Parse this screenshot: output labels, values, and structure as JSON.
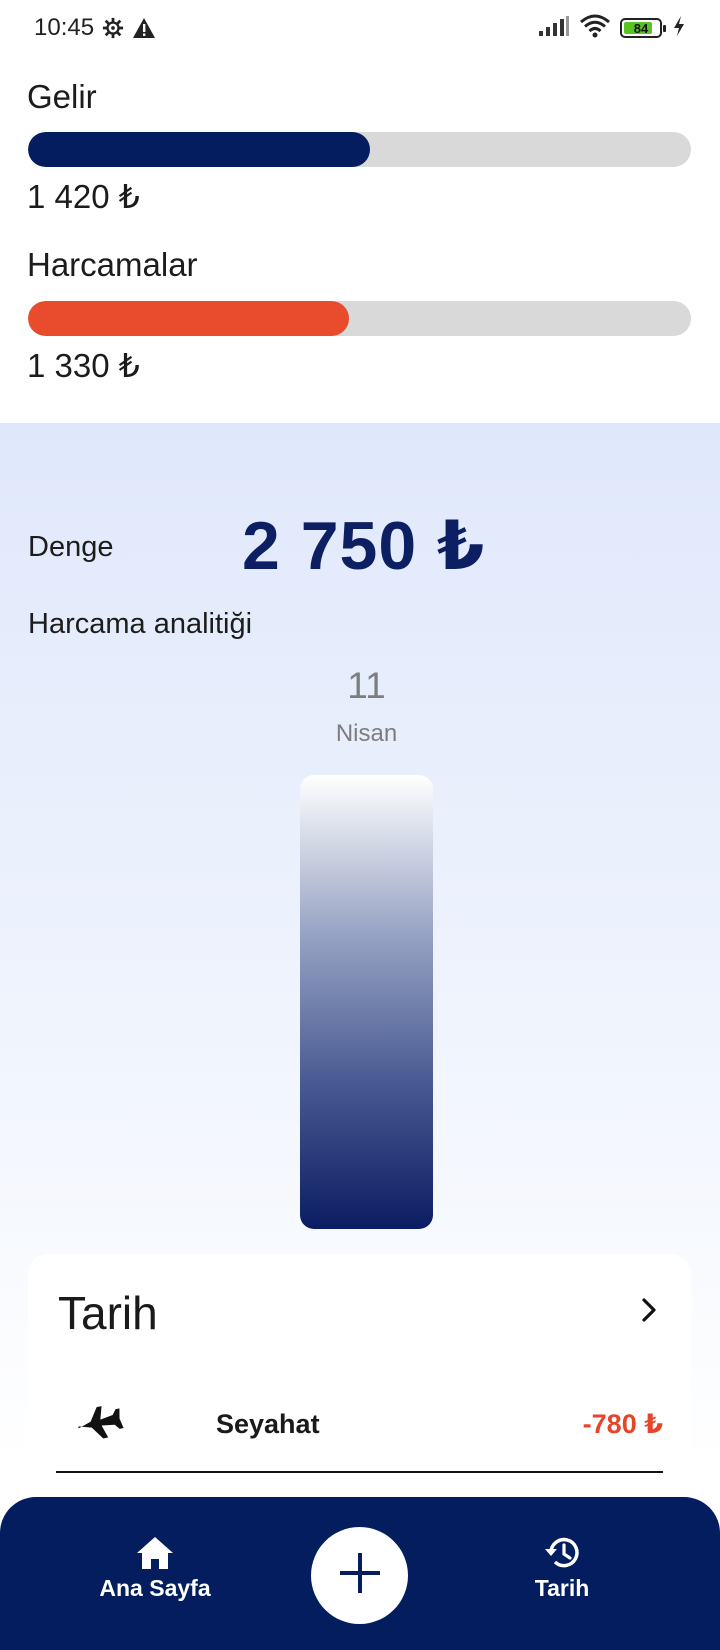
{
  "status_bar": {
    "time": "10:45",
    "battery_level": "84",
    "battery_fraction": 0.84,
    "icons": [
      "settings-gear-icon",
      "warning-icon",
      "signal-icon",
      "wifi-icon",
      "battery-icon",
      "charging-bolt-icon"
    ]
  },
  "income": {
    "label": "Gelir",
    "value": "1 420 ₺",
    "fraction": 0.516,
    "color": "#031d5e"
  },
  "expenses": {
    "label": "Harcamalar",
    "value": "1 330 ₺",
    "fraction": 0.484,
    "color": "#e84c2c"
  },
  "balance": {
    "label": "Denge",
    "value": "2 750 ₺"
  },
  "analytics": {
    "title": "Harcama analitiği",
    "bar": {
      "day": "11",
      "month": "Nisan",
      "fraction": 1.0
    }
  },
  "history": {
    "title": "Tarih",
    "transactions": [
      {
        "icon": "airplane-icon",
        "name": "Seyahat",
        "amount": "-780 ₺"
      }
    ]
  },
  "bottom_nav": {
    "home_label": "Ana Sayfa",
    "history_label": "Tarih",
    "add_icon": "plus-icon"
  },
  "colors": {
    "brand_navy": "#031d5e",
    "expense_red": "#e84c2c",
    "track_gray": "#d9d9d9",
    "negative_amount": "#e6452a"
  }
}
